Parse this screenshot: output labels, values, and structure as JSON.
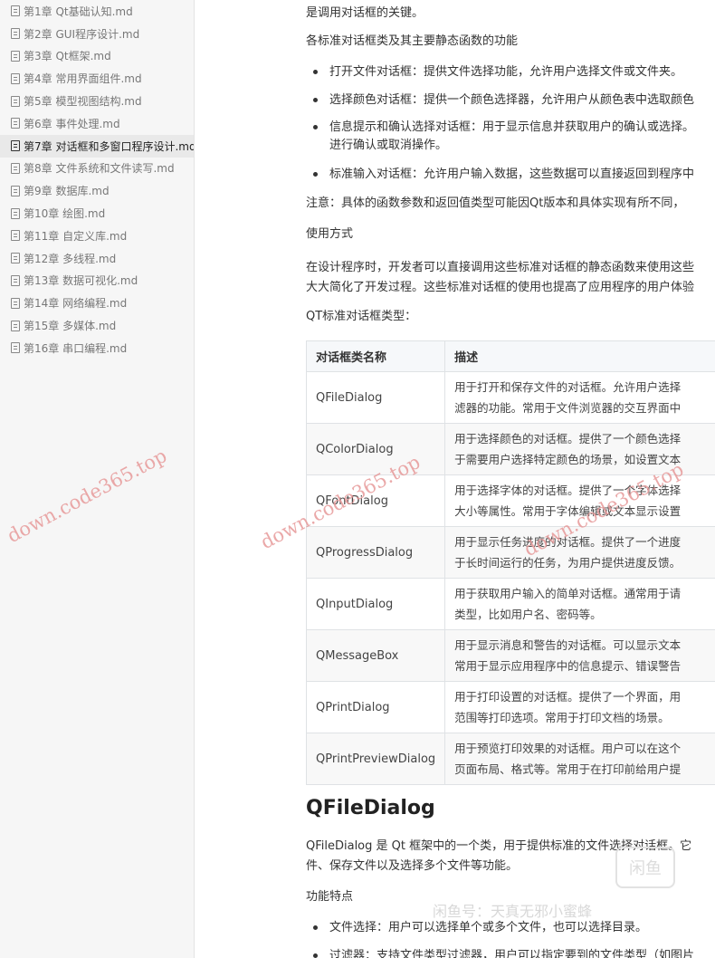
{
  "sidebar": {
    "items": [
      {
        "label": "第1章 Qt基础认知.md",
        "active": false
      },
      {
        "label": "第2章 GUI程序设计.md",
        "active": false
      },
      {
        "label": "第3章 Qt框架.md",
        "active": false
      },
      {
        "label": "第4章 常用界面组件.md",
        "active": false
      },
      {
        "label": "第5章 模型视图结构.md",
        "active": false
      },
      {
        "label": "第6章 事件处理.md",
        "active": false
      },
      {
        "label": "第7章 对话框和多窗口程序设计.md",
        "active": true
      },
      {
        "label": "第8章 文件系统和文件读写.md",
        "active": false
      },
      {
        "label": "第9章 数据库.md",
        "active": false
      },
      {
        "label": "第10章 绘图.md",
        "active": false
      },
      {
        "label": "第11章 自定义库.md",
        "active": false
      },
      {
        "label": "第12章 多线程.md",
        "active": false
      },
      {
        "label": "第13章 数据可视化.md",
        "active": false
      },
      {
        "label": "第14章 网络编程.md",
        "active": false
      },
      {
        "label": "第15章 多媒体.md",
        "active": false
      },
      {
        "label": "第16章 串口编程.md",
        "active": false
      }
    ]
  },
  "main": {
    "p1": "是调用对话框的关键。",
    "p2": "各标准对话框类及其主要静态函数的功能",
    "bullets": [
      "打开文件对话框：提供文件选择功能，允许用户选择文件或文件夹。",
      "选择颜色对话框：提供一个颜色选择器，允许用户从颜色表中选取颜色",
      "信息提示和确认选择对话框：用于显示信息并获取用户的确认或选择。",
      "标准输入对话框：允许用户输入数据，这些数据可以直接返回到程序中"
    ],
    "bullet3_cont": "进行确认或取消操作。",
    "note": "注意：具体的函数参数和返回值类型可能因Qt版本和具体实现有所不同，",
    "usage_title": "使用方式",
    "usage_p1": "在设计程序时，开发者可以直接调用这些标准对话框的静态函数来使用这些",
    "usage_p2": "大大简化了开发过程。这些标准对话框的使用也提高了应用程序的用户体验",
    "table_intro": "QT标准对话框类型：",
    "table": {
      "headers": [
        "对话框类名称",
        "描述"
      ],
      "rows": [
        {
          "name": "QFileDialog",
          "d1": "用于打开和保存文件的对话框。允许用户选择",
          "d2": "滤器的功能。常用于文件浏览器的交互界面中"
        },
        {
          "name": "QColorDialog",
          "d1": "用于选择颜色的对话框。提供了一个颜色选择",
          "d2": "于需要用户选择特定颜色的场景，如设置文本"
        },
        {
          "name": "QFontDialog",
          "d1": "用于选择字体的对话框。提供了一个字体选择",
          "d2": "大小等属性。常用于字体编辑或文本显示设置"
        },
        {
          "name": "QProgressDialog",
          "d1": "用于显示任务进度的对话框。提供了一个进度",
          "d2": "于长时间运行的任务，为用户提供进度反馈。"
        },
        {
          "name": "QInputDialog",
          "d1": "用于获取用户输入的简单对话框。通常用于请",
          "d2": "类型，比如用户名、密码等。"
        },
        {
          "name": "QMessageBox",
          "d1": "用于显示消息和警告的对话框。可以显示文本",
          "d2": "常用于显示应用程序中的信息提示、错误警告"
        },
        {
          "name": "QPrintDialog",
          "d1": "用于打印设置的对话框。提供了一个界面，用",
          "d2": "范围等打印选项。常用于打印文档的场景。"
        },
        {
          "name": "QPrintPreviewDialog",
          "d1": "用于预览打印效果的对话框。用户可以在这个",
          "d2": "页面布局、格式等。常用于在打印前给用户提"
        }
      ]
    },
    "section_heading": "QFileDialog",
    "section_p1": " QFileDialog  是 Qt 框架中的一个类，用于提供标准的文件选择对话框。它",
    "section_p2": "件、保存文件以及选择多个文件等功能。",
    "features_title": "功能特点",
    "features": [
      "文件选择：用户可以选择单个或多个文件，也可以选择目录。"
    ],
    "features_partial": "过滤器：支持文件类型过滤器，用户可以指定要到的文件类型（如图片"
  },
  "watermarks": {
    "site": "down.code365.top",
    "bottom_text": "闲鱼号：天真无邪小蜜蜂",
    "logo_text": "闲鱼"
  }
}
